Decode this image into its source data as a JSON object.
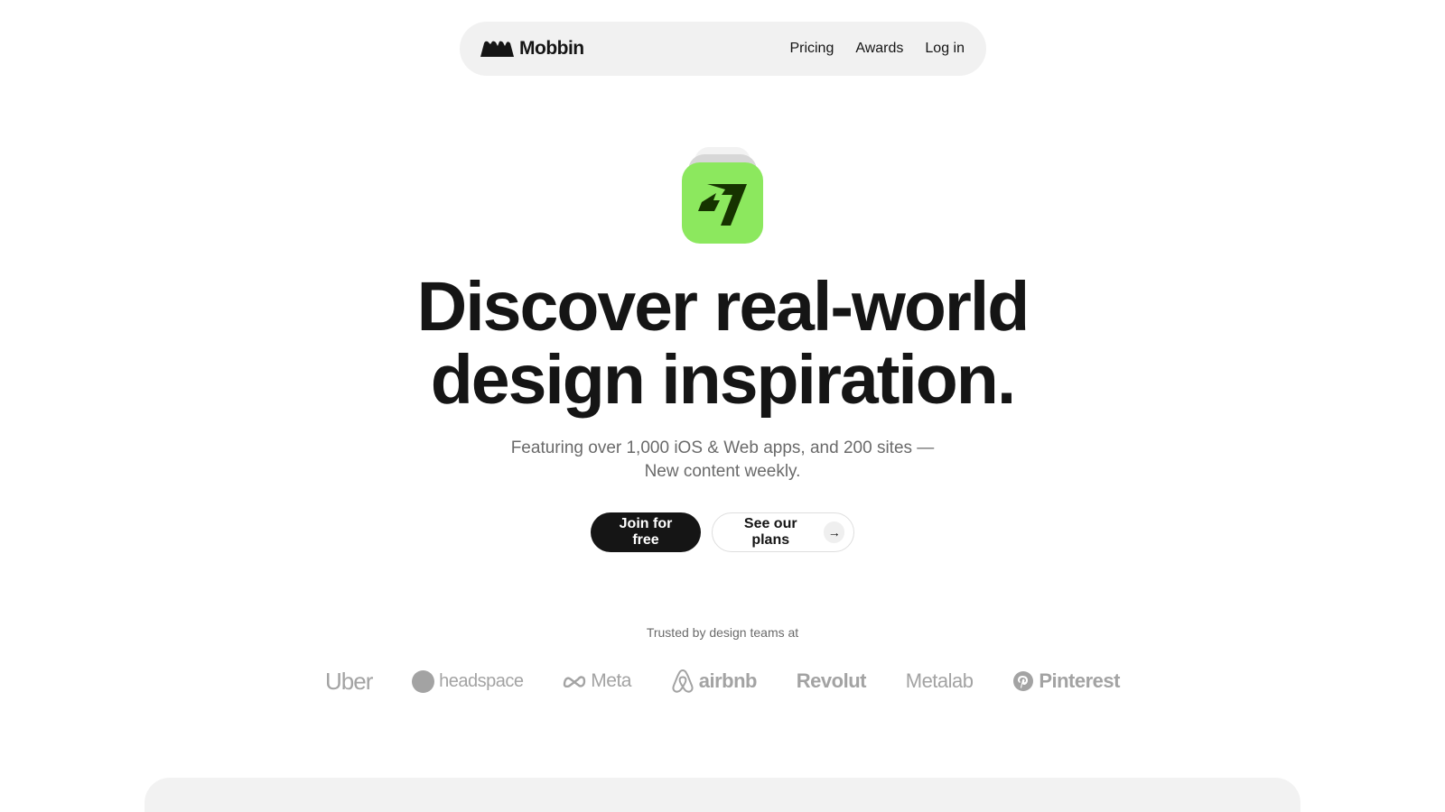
{
  "nav": {
    "brand_name": "Mobbin",
    "links": [
      "Pricing",
      "Awards",
      "Log in"
    ]
  },
  "hero": {
    "title_line1": "Discover real-world",
    "title_line2": "design inspiration.",
    "subtitle_line1": "Featuring over 1,000 iOS & Web apps, and 200 sites —",
    "subtitle_line2": "New content weekly.",
    "primary_cta": "Join for free",
    "secondary_cta": "See our plans"
  },
  "featured_app_icon": "wise-app-icon",
  "colors": {
    "accent_green": "#8ce85e",
    "primary_button": "#151515",
    "logo_gray": "#a3a3a3"
  },
  "trusted": {
    "label": "Trusted by design teams at",
    "logos": [
      "Uber",
      "headspace",
      "Meta",
      "airbnb",
      "Revolut",
      "Metalab",
      "Pinterest"
    ]
  },
  "icons": {
    "arrow": "→"
  }
}
